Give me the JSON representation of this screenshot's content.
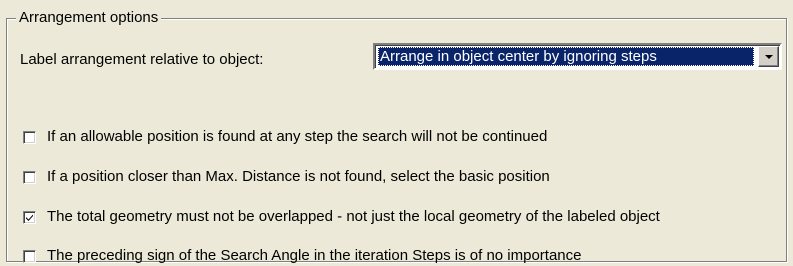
{
  "group": {
    "title": "Arrangement options"
  },
  "arrangement": {
    "label": "Label arrangement relative to object:",
    "selected_value": "Arrange in object center by ignoring steps"
  },
  "options": [
    {
      "label": "If an allowable position is found at any step the search will not be continued",
      "checked": false
    },
    {
      "label": "If a position closer than Max. Distance is not found, select the basic position",
      "checked": false
    },
    {
      "label": "The total geometry must not be overlapped - not just the local geometry of the labeled object",
      "checked": true
    },
    {
      "label": "The preceding sign of the Search Angle in the iteration Steps is of no importance",
      "checked": false
    }
  ],
  "icons": {
    "dropdown": "chevron-down-icon",
    "check": "checkmark-icon"
  }
}
